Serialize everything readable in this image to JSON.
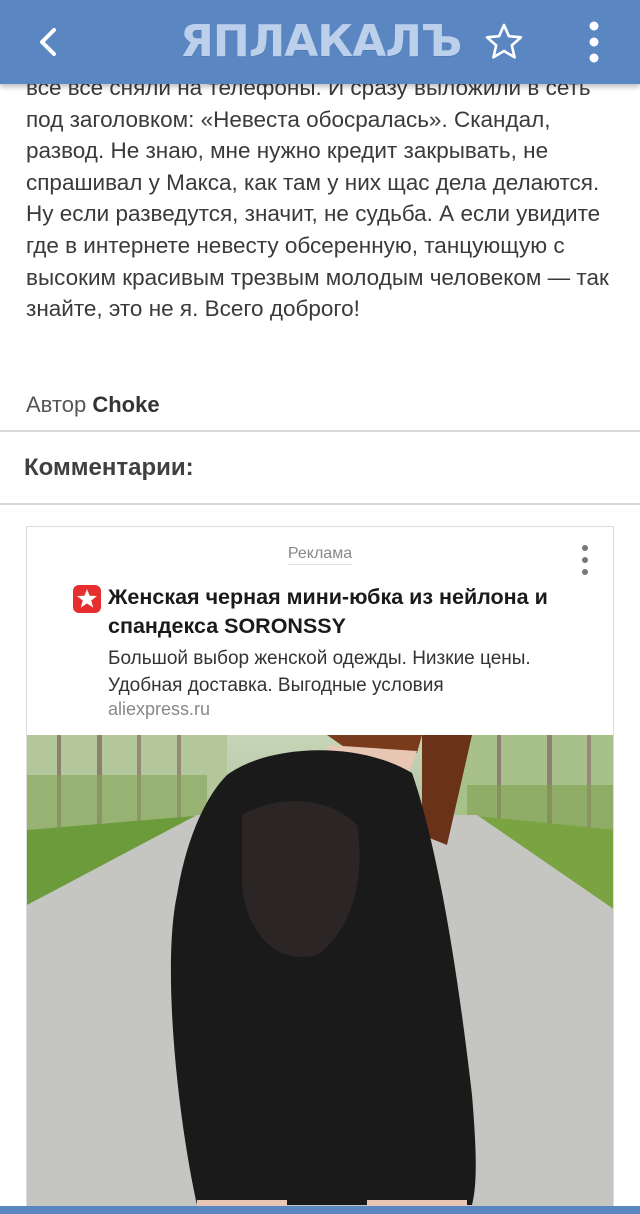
{
  "header": {
    "logo_text": "ЯПЛАКАЛЪ",
    "back_icon": "chevron-left-icon",
    "favorite_icon": "star-outline-icon",
    "menu_icon": "vertical-dots-icon",
    "bar_color": "#5a86c2"
  },
  "article": {
    "text": "все все сняли на телефоны. И сразу выложили в сеть под заголовком: «Невеста обосралась». Скандал, развод. Не знаю, мне нужно кредит закрывать, не спрашивал у Макса, как там у них щас дела делаются. Ну если разведутся, значит, не судьба. А если увидите где в интернете невесту обсеренную, танцующую с высоким красивым трезвым молодым человеком — так знайте, это не я. Всего доброго!",
    "author_label": "Автор",
    "author_name": "Choke"
  },
  "comments": {
    "title": "Комментарии:"
  },
  "ad": {
    "label": "Реклама",
    "title": "Женская черная мини-юбка из нейлона и спандекса SORONSSY",
    "description": "Большой выбор женской одежды. Низкие цены. Удобная доставка. Выгодные условия",
    "domain": "aliexpress.ru",
    "brand_icon": "aliexpress-logo-icon",
    "brand_color": "#e62e2e"
  }
}
